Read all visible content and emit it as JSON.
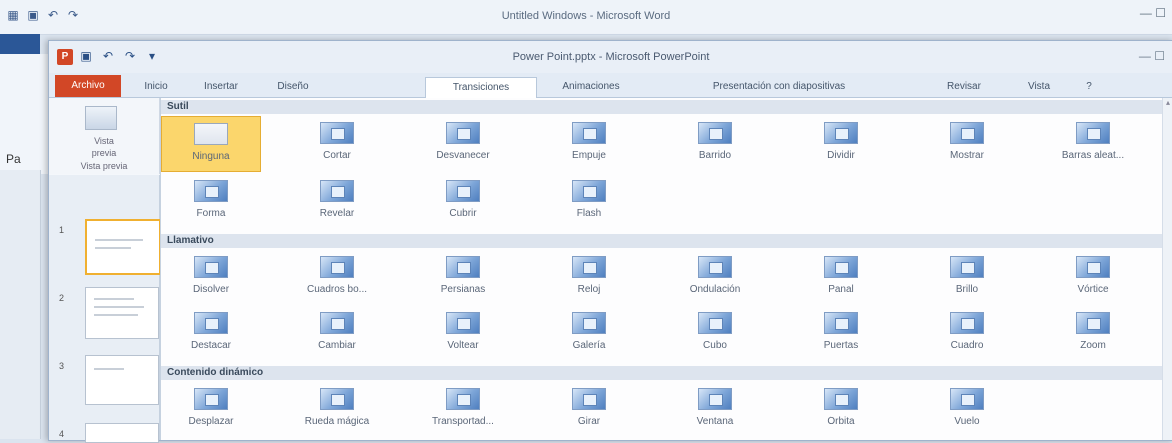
{
  "background_window": {
    "title": "Untitled Windows - Microsoft Word",
    "pa": "Pa"
  },
  "ppt": {
    "logo": "P",
    "title": "Power Point.pptx - Microsoft PowerPoint",
    "window_controls": "— ☐",
    "tabs": [
      "Archivo",
      "Inicio",
      "Insertar",
      "Diseño",
      "Transiciones",
      "Animaciones",
      "Presentación con diapositivas",
      "Revisar",
      "Vista"
    ],
    "active_tab": "Transiciones",
    "preview": {
      "label1": "Vista",
      "label2": "previa",
      "label3": "Vista previa"
    },
    "slide_numbers": [
      "1",
      "2",
      "3",
      "4"
    ]
  },
  "gallery": {
    "sections": [
      {
        "header": "Sutil",
        "items": [
          "Ninguna",
          "Cortar",
          "Desvanecer",
          "Empuje",
          "Barrido",
          "Dividir",
          "Mostrar",
          "Barras aleat...",
          "Forma",
          "Revelar",
          "Cubrir",
          "Flash"
        ]
      },
      {
        "header": "Llamativo",
        "items": [
          "Disolver",
          "Cuadros bo...",
          "Persianas",
          "Reloj",
          "Ondulación",
          "Panal",
          "Brillo",
          "Vórtice",
          "Destacar",
          "Cambiar",
          "Voltear",
          "Galería",
          "Cubo",
          "Puertas",
          "Cuadro",
          "Zoom"
        ]
      },
      {
        "header": "Contenido dinámico",
        "items": [
          "Desplazar",
          "Rueda mágica",
          "Transportad...",
          "Girar",
          "Ventana",
          "Órbita",
          "Vuelo"
        ]
      }
    ],
    "selected_item": "Ninguna"
  }
}
